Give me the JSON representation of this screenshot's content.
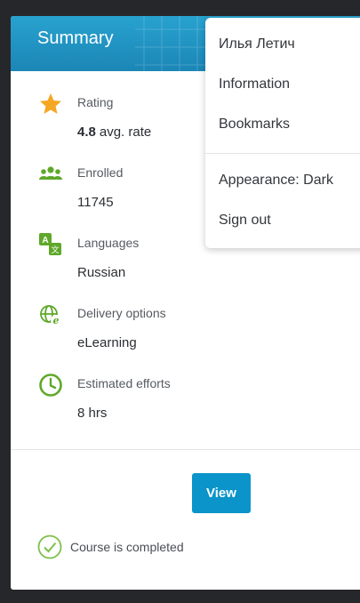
{
  "card": {
    "title": "Summary"
  },
  "info": [
    {
      "icon": "star-icon",
      "label": "Rating",
      "value_bold": "4.8",
      "value": "avg. rate"
    },
    {
      "icon": "people-icon",
      "label": "Enrolled",
      "value": "11745"
    },
    {
      "icon": "translate-icon",
      "label": "Languages",
      "value": "Russian"
    },
    {
      "icon": "globe-e-icon",
      "label": "Delivery options",
      "value": "eLearning"
    },
    {
      "icon": "clock-icon",
      "label": "Estimated efforts",
      "value": "8 hrs"
    }
  ],
  "actions": {
    "view_label": "View",
    "completed_text": "Course is completed"
  },
  "menu": {
    "user_name": "Илья Летич",
    "items": [
      "Information",
      "Bookmarks"
    ],
    "appearance": "Appearance: Dark",
    "sign_out": "Sign out"
  },
  "colors": {
    "header": "#1b86b6",
    "accent_green": "#5fa82a",
    "star": "#f5a623",
    "button": "#0a94c9",
    "background": "#26272b"
  }
}
